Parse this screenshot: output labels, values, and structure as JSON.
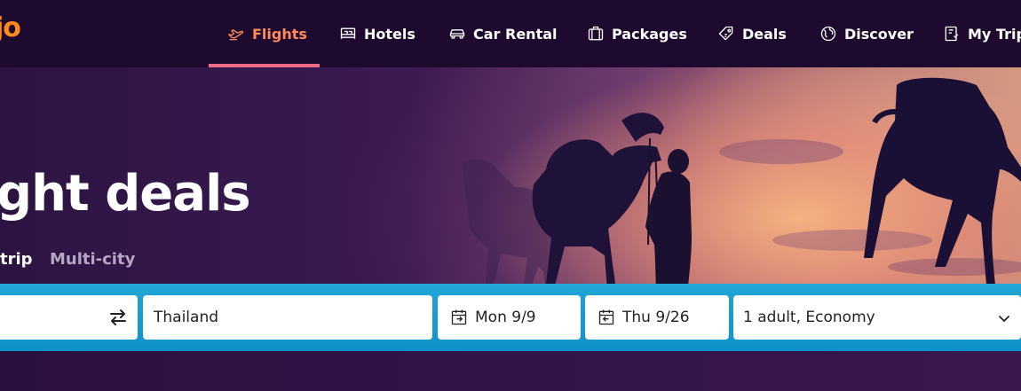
{
  "logo": {
    "text": "jo"
  },
  "nav": {
    "items": [
      {
        "label": "Flights",
        "icon": "plane-icon",
        "active": true
      },
      {
        "label": "Hotels",
        "icon": "bed-icon",
        "active": false
      },
      {
        "label": "Car Rental",
        "icon": "car-icon",
        "active": false
      },
      {
        "label": "Packages",
        "icon": "suitcase-icon",
        "active": false
      },
      {
        "label": "Deals",
        "icon": "tag-icon",
        "active": false
      },
      {
        "label": "Discover",
        "icon": "globe-icon",
        "active": false
      },
      {
        "label": "My Trip",
        "icon": "itinerary-icon",
        "active": false
      }
    ],
    "active_color": "#ff8a5c",
    "indicator_color": "#f06a8a"
  },
  "hero": {
    "title": "ght deals",
    "trip_types": [
      {
        "label": "trip",
        "selected": true
      },
      {
        "label": "Multi-city",
        "selected": false
      }
    ]
  },
  "search": {
    "origin_value": "",
    "destination_value": "Thailand",
    "depart_date": "Mon 9/9",
    "return_date": "Thu 9/26",
    "travelers": "1 adult, Economy"
  },
  "colors": {
    "nav_bg": "#1e0a2e",
    "search_bar": "#0d92c9",
    "logo": "#ff8a1e"
  }
}
